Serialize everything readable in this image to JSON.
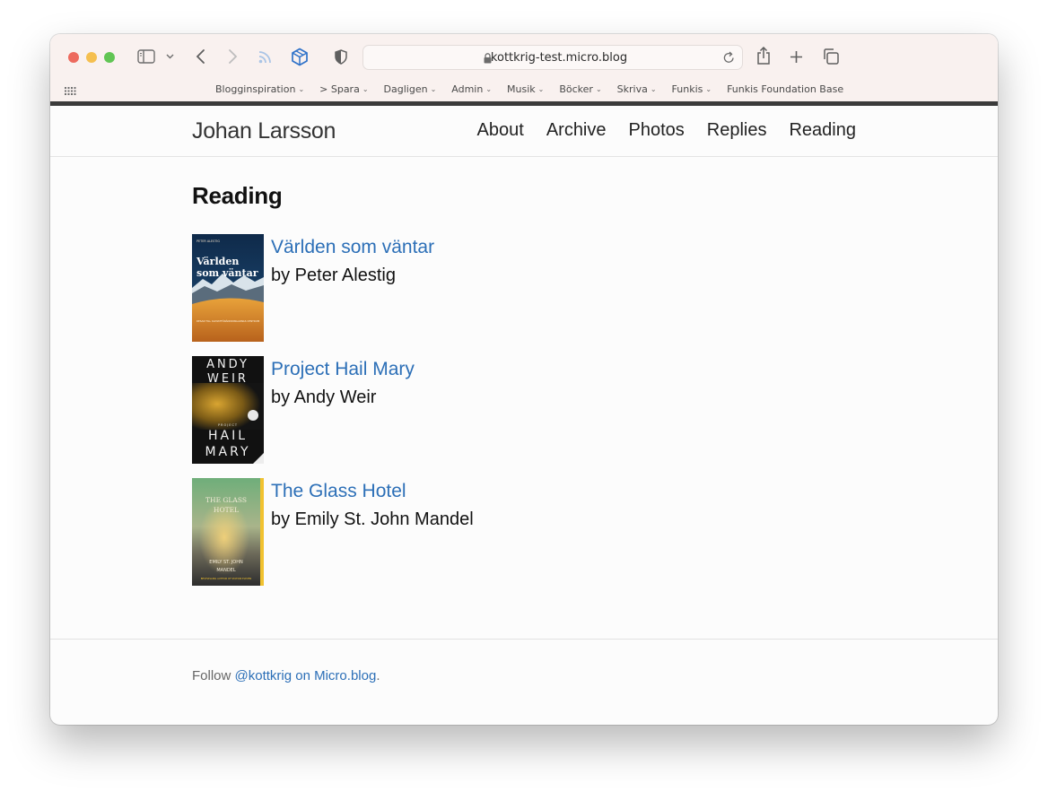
{
  "browser": {
    "url": "kottkrig-test.micro.blog",
    "bookmarks": [
      "Blogginspiration",
      "> Spara",
      "Dagligen",
      "Admin",
      "Musik",
      "Böcker",
      "Skriva",
      "Funkis",
      "Funkis Foundation Base"
    ]
  },
  "site": {
    "title": "Johan Larsson",
    "nav": [
      "About",
      "Archive",
      "Photos",
      "Replies",
      "Reading"
    ]
  },
  "page": {
    "heading": "Reading",
    "books": [
      {
        "title": "Världen som väntar",
        "author": "by Peter Alestig",
        "cover_text": [
          "PETER ALESTIG",
          "Världen",
          "som väntar",
          "RESAN TILL KLIMATFÖRÄNDRINGARNAS CENTRUM"
        ]
      },
      {
        "title": "Project Hail Mary",
        "author": "by Andy Weir",
        "cover_text": [
          "ANDY",
          "WEIR",
          "PROJECT",
          "HAIL",
          "MARY"
        ]
      },
      {
        "title": "The Glass Hotel",
        "author": "by Emily St. John Mandel",
        "cover_text": [
          "THE GLASS",
          "HOTEL",
          "EMILY ST. JOHN",
          "MANDEL",
          "BESTSELLING AUTHOR OF STATION ELEVEN"
        ]
      }
    ]
  },
  "footer": {
    "prefix": "Follow ",
    "link": "@kottkrig on Micro.blog",
    "suffix": "."
  }
}
